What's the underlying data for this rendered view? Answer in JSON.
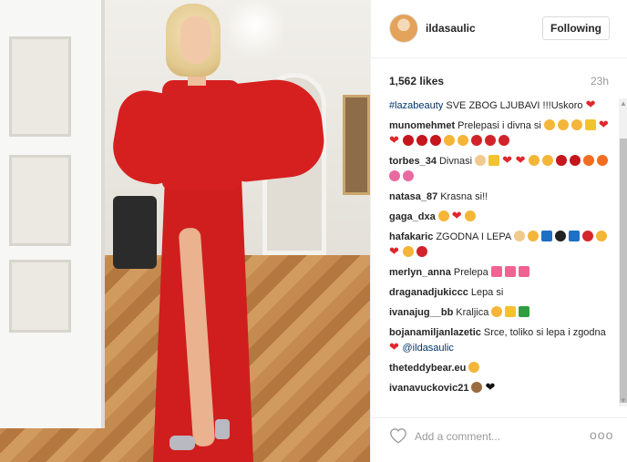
{
  "post": {
    "username": "ildasaulic",
    "follow_label": "Following",
    "likes": "1,562 likes",
    "time_ago": "23h"
  },
  "comments": [
    {
      "author": "",
      "hashtag": "#lazabeauty",
      "text": " SVE ZBOG LJUBAVI !!!Uskoro",
      "emojis": [
        "heart"
      ]
    },
    {
      "author": "munomehmet",
      "text": "Prelepasi i divna si",
      "emojis": [
        "hands",
        "hands",
        "hands",
        "crown",
        "heart",
        "heart",
        "lips",
        "lips",
        "lips",
        "face",
        "face",
        "rose",
        "rose",
        "rose"
      ]
    },
    {
      "author": "torbes_34",
      "text": "Divnasi",
      "emojis": [
        "thumb",
        "crown",
        "heart",
        "heart",
        "face",
        "face",
        "lips",
        "lips",
        "fire",
        "fire",
        "tulip",
        "tulip"
      ]
    },
    {
      "author": "natasa_87",
      "text": "Krasna si!!",
      "emojis": []
    },
    {
      "author": "gaga_dxa",
      "text": "",
      "emojis": [
        "face",
        "heart",
        "face"
      ]
    },
    {
      "author": "hafakaric",
      "text": "ZGODNA I LEPA",
      "emojis": [
        "thumb",
        "hands",
        "box",
        "bomb",
        "box",
        "dancer",
        "face",
        "heart",
        "face",
        "rose"
      ]
    },
    {
      "author": "merlyn_anna",
      "text": "Prelepa",
      "emojis": [
        "heart-box",
        "heart-box",
        "heart-box"
      ]
    },
    {
      "author": "draganadjukiccc",
      "text": "Lepa si",
      "emojis": []
    },
    {
      "author": "ivanajug__bb",
      "text": "Kraljica",
      "emojis": [
        "face",
        "crown",
        "dollar"
      ]
    },
    {
      "author": "bojanamiljanlazetic",
      "text": "Srce, toliko si lepa i zgodna",
      "emojis": [
        "heart"
      ],
      "mention": "@ildasaulic"
    },
    {
      "author": "theteddybear.eu",
      "text": "",
      "emojis": [
        "hands"
      ]
    },
    {
      "author": "ivanavuckovic21",
      "text": "",
      "emojis": [
        "monkey",
        "black-heart"
      ]
    }
  ],
  "footer": {
    "comment_placeholder": "Add a comment...",
    "more_label": "ooo"
  },
  "colors": {
    "link": "#003569",
    "heart": "#e0262b",
    "text": "#262626",
    "muted": "#999999"
  }
}
